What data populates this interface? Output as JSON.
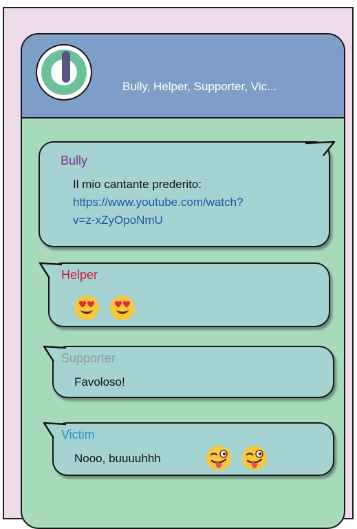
{
  "chat": {
    "title": "Bully, Helper, Supporter, Vic...",
    "messages": [
      {
        "sender": "Bully",
        "sender_color": "#7b2c86",
        "text": "Il mio cantante prederito:",
        "link_line1": "https://www.youtube.com/watch?",
        "link_line2": "v=z-xZyOpoNmU"
      },
      {
        "sender": "Helper",
        "sender_color": "#d4173f",
        "emojis": [
          "heart-eyes-emoji",
          "heart-eyes-emoji"
        ]
      },
      {
        "sender": "Supporter",
        "sender_color": "#8e9a9e",
        "text": "Favoloso!"
      },
      {
        "sender": "Victim",
        "sender_color": "#2e8fc7",
        "text": "Nooo, buuuuhhh",
        "emojis": [
          "winking-tongue-emoji",
          "winking-tongue-emoji"
        ]
      }
    ]
  },
  "colors": {
    "background": "#efdcea",
    "chat_area": "#a7d9bb",
    "header": "#7e9dc7",
    "bubble": "#a5d3d2"
  }
}
